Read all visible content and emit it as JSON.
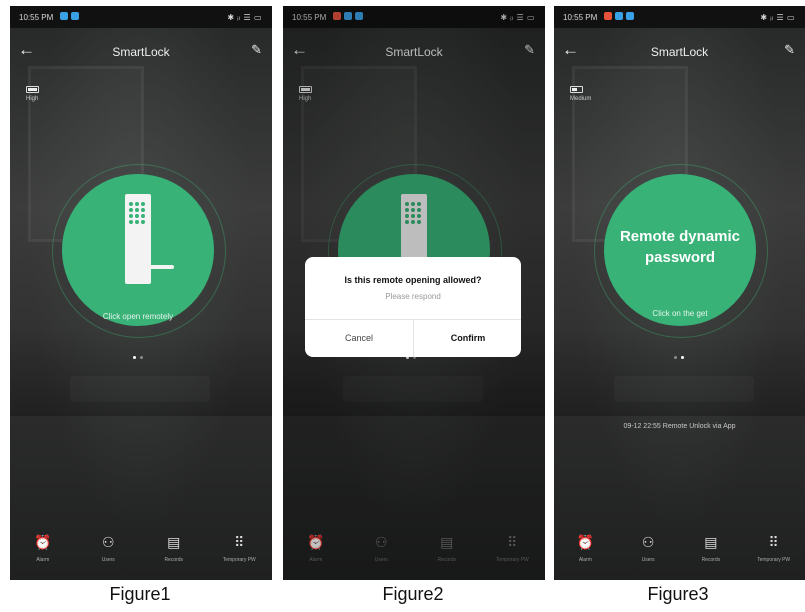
{
  "screens": [
    {
      "status": {
        "time": "10:55 PM",
        "icons": "✱ ᵢₗ ☰ ▭",
        "dots": [
          "#3aa0e6",
          "#3aa0e6"
        ]
      },
      "header": {
        "title": "SmartLock"
      },
      "battery": {
        "label": "High",
        "level": 1.0
      },
      "circle_label": "Click open remotely",
      "tabs": [
        "Alarm",
        "Users",
        "Records",
        "Temporary PW"
      ],
      "caption": "Figure1"
    },
    {
      "status": {
        "time": "10:55 PM",
        "icons": "✱ ᵢₗ ☰ ▭",
        "dots": [
          "#e5533b",
          "#3aa0e6",
          "#3aa0e6"
        ]
      },
      "header": {
        "title": "SmartLock"
      },
      "battery": {
        "label": "High",
        "level": 1.0
      },
      "dialog": {
        "title": "Is this remote opening allowed?",
        "subtitle": "Please respond",
        "cancel": "Cancel",
        "confirm": "Confirm"
      },
      "tabs": [
        "Alarm",
        "Users",
        "Records",
        "Temporary PW"
      ],
      "caption": "Figure2"
    },
    {
      "status": {
        "time": "10:55 PM",
        "icons": "✱ ᵢₗ ☰ ▭",
        "dots": [
          "#e5533b",
          "#3aa0e6",
          "#3aa0e6"
        ]
      },
      "header": {
        "title": "SmartLock"
      },
      "battery": {
        "label": "Medium",
        "level": 0.5
      },
      "circle_title_1": "Remote dynamic",
      "circle_title_2": "password",
      "circle_label": "Click on the get",
      "record": "09-12 22:55  Remote Unlock via App",
      "tabs": [
        "Alarm",
        "Users",
        "Records",
        "Temporary PW"
      ],
      "caption": "Figure3"
    }
  ],
  "icons": {
    "back": "arrow-left-icon",
    "edit": "pencil-icon",
    "tabs": [
      "alarm-icon",
      "users-icon",
      "records-icon",
      "keypad-icon"
    ]
  }
}
